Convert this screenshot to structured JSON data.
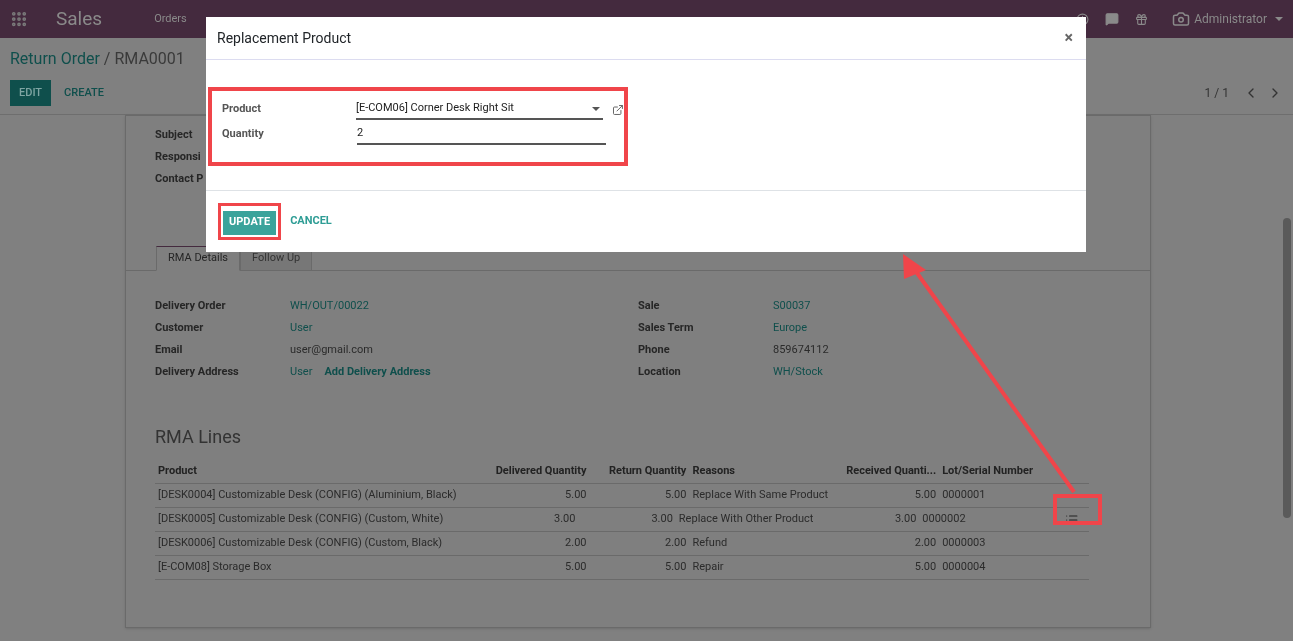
{
  "navbar": {
    "app_name": "Sales",
    "menu": [
      "Orders"
    ],
    "user": "Administrator"
  },
  "breadcrumb": {
    "parent": "Return Order",
    "separator": "/",
    "current": "RMA0001"
  },
  "actions": {
    "edit": "EDIT",
    "create": "CREATE",
    "pager": "1 / 1"
  },
  "top_fields": [
    "Subject",
    "Responsi",
    "Contact P"
  ],
  "tabs": [
    {
      "label": "RMA Details",
      "selected": true
    },
    {
      "label": "Follow Up",
      "selected": false
    }
  ],
  "details_left": [
    {
      "label": "Delivery Order",
      "value": "WH/OUT/00022",
      "kind": "link"
    },
    {
      "label": "Customer",
      "value": "User",
      "kind": "link"
    },
    {
      "label": "Email",
      "value": "user@gmail.com",
      "kind": "text"
    },
    {
      "label": "Delivery Address",
      "value": "User",
      "kind": "link",
      "extra_link": "Add Delivery Address"
    }
  ],
  "details_right": [
    {
      "label": "Sale",
      "value": "S00037",
      "kind": "link"
    },
    {
      "label": "Sales Term",
      "value": "Europe",
      "kind": "link"
    },
    {
      "label": "Phone",
      "value": "859674112",
      "kind": "text"
    },
    {
      "label": "Location",
      "value": "WH/Stock",
      "kind": "link"
    }
  ],
  "rma_lines": {
    "title": "RMA Lines",
    "columns": [
      "Product",
      "Delivered Quantity",
      "Return Quantity",
      "Reasons",
      "Received Quanti...",
      "Lot/Serial Number"
    ],
    "rows": [
      {
        "cells": [
          "[DESK0004] Customizable Desk (CONFIG) (Aluminium, Black)",
          "5.00",
          "5.00",
          "Replace With Same Product",
          "5.00",
          "0000001"
        ],
        "action_button": false
      },
      {
        "cells": [
          "[DESK0005] Customizable Desk (CONFIG) (Custom, White)",
          "3.00",
          "3.00",
          "Replace With Other Product",
          "3.00",
          "0000002"
        ],
        "action_button": true
      },
      {
        "cells": [
          "[DESK0006] Customizable Desk (CONFIG) (Custom, Black)",
          "2.00",
          "2.00",
          "Refund",
          "2.00",
          "0000003"
        ],
        "action_button": false
      },
      {
        "cells": [
          "[E-COM08] Storage Box",
          "5.00",
          "5.00",
          "Repair",
          "5.00",
          "0000004"
        ],
        "action_button": false
      }
    ]
  },
  "modal": {
    "title": "Replacement Product",
    "close": "×",
    "fields": [
      {
        "label": "Product",
        "value": "[E-COM06] Corner Desk Right Sit",
        "kind": "select"
      },
      {
        "label": "Quantity",
        "value": "2",
        "kind": "text"
      }
    ],
    "update": "UPDATE",
    "cancel": "CANCEL"
  }
}
